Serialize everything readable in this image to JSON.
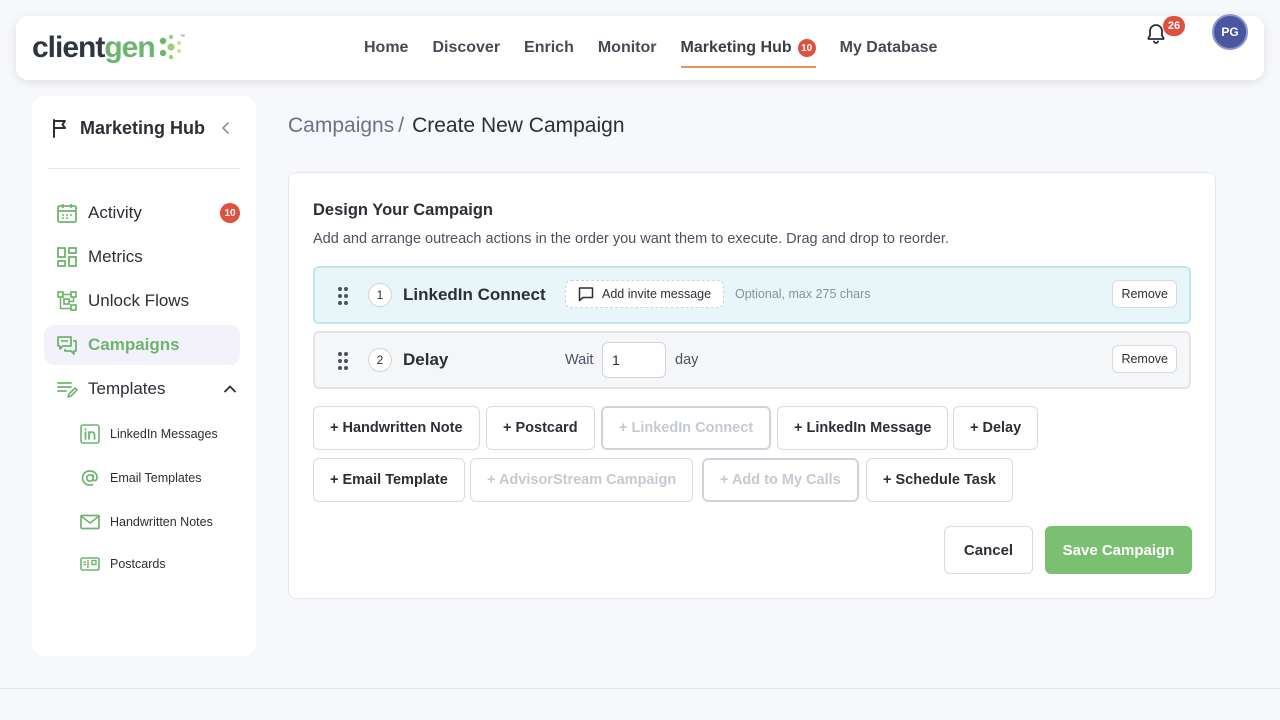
{
  "brand": {
    "logo_part1": "client",
    "logo_part2": "gen",
    "trademark": "™"
  },
  "nav": {
    "items": [
      {
        "label": "Home"
      },
      {
        "label": "Discover"
      },
      {
        "label": "Enrich"
      },
      {
        "label": "Monitor"
      },
      {
        "label": "Marketing Hub",
        "badge": "10",
        "active": true
      },
      {
        "label": "My Database"
      }
    ]
  },
  "header": {
    "notification_count": "26",
    "avatar_initials": "PG"
  },
  "sidebar": {
    "title": "Marketing Hub",
    "items": [
      {
        "label": "Activity",
        "badge": "10",
        "icon": "calendar-icon"
      },
      {
        "label": "Metrics",
        "icon": "dashboard-icon"
      },
      {
        "label": "Unlock Flows",
        "icon": "flow-icon"
      },
      {
        "label": "Campaigns",
        "icon": "chat-icon",
        "active": true
      },
      {
        "label": "Templates",
        "icon": "edit-list-icon",
        "expanded": true
      }
    ],
    "sub_items": [
      {
        "label": "LinkedIn Messages",
        "icon": "linkedin-icon"
      },
      {
        "label": "Email Templates",
        "icon": "at-icon"
      },
      {
        "label": "Handwritten Notes",
        "icon": "envelope-icon"
      },
      {
        "label": "Postcards",
        "icon": "postcard-icon"
      }
    ],
    "accent": "#6db56e"
  },
  "breadcrumb": {
    "parent": "Campaigns",
    "separator": "/",
    "current": "Create New Campaign"
  },
  "campaign": {
    "title": "Design Your Campaign",
    "description": "Add and arrange outreach actions in the order you want them to execute. Drag and drop to reorder.",
    "steps": [
      {
        "number": "1",
        "name": "LinkedIn Connect",
        "action_label": "Add invite message",
        "hint": "Optional, max 275 chars",
        "remove_label": "Remove"
      },
      {
        "number": "2",
        "name": "Delay",
        "wait_label": "Wait",
        "wait_value": "1",
        "unit": "day",
        "remove_label": "Remove"
      }
    ],
    "add_buttons": [
      {
        "label": "+ Handwritten Note"
      },
      {
        "label": "+ Postcard"
      },
      {
        "label": "+ LinkedIn Connect",
        "disabled": true
      },
      {
        "label": "+ LinkedIn Message"
      },
      {
        "label": "+ Delay"
      },
      {
        "label": "+ Email Template"
      },
      {
        "label": "+ AdvisorStream Campaign",
        "disabled": true
      },
      {
        "label": "+ Add to My Calls",
        "disabled": true
      },
      {
        "label": "+ Schedule Task"
      }
    ],
    "cancel_label": "Cancel",
    "save_label": "Save Campaign",
    "save_color": "#7bbf73"
  }
}
